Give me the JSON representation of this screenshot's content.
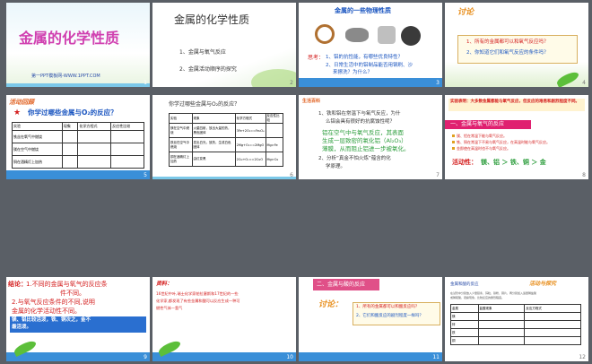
{
  "slides": [
    {
      "num": "1",
      "title": "金属的化学性质",
      "sub": "第一PPT模板网-WWW.1PPT.COM"
    },
    {
      "num": "2",
      "title": "金属的化学性质",
      "items": [
        "1、金属与氧气反应",
        "2、金属活动顺序的探究"
      ]
    },
    {
      "num": "3",
      "title": "金属的一些物理性质",
      "q_label": "思考：",
      "q1": "1、铝的抗性能，有哪些优良特性？",
      "q2": "2、日常生活中的铝制品能否用钢刷、沙",
      "q3": "来擦洗？为什么？"
    },
    {
      "num": "4",
      "title": "讨论",
      "items": [
        "1、所有的金属都可以和氧气反应吗？",
        "2、你知道它们和氧气反应的条件吗？"
      ]
    },
    {
      "num": "5",
      "banner": "活动回顾",
      "q": "你学过哪些金属与O₂的反应？",
      "headers": [
        "实验",
        "现象",
        "化学方程式",
        "反应性比较"
      ],
      "rows": [
        "铁丝在氧气中燃烧",
        "镁在空气中燃烧",
        "铜在酒精灯上加热"
      ]
    },
    {
      "num": "6",
      "q": "你学过哪些金属与O₂的反应？",
      "headers": [
        "实验",
        "现象",
        "化学方程式",
        "反应性比较"
      ],
      "rows": [
        [
          "镁在空气中燃烧",
          "火星四射，放出大量的热，黑色固体",
          "3Fe+2O₂==Fe₃O₄",
          ""
        ],
        [
          "铁丝在空气中燃烧",
          "发出白光，放热，生成白色固体",
          "2Mg+O₂==2MgO",
          "Mg>Fe"
        ],
        [
          "铜在酒精灯上加热",
          "由红变黑",
          "2Cu+O₂==2CuO",
          "Mg>Cu"
        ]
      ]
    },
    {
      "num": "7",
      "label": "生活百科",
      "q1": "1、铁和铝在常温下与氧气反应，为什",
      "q2": "么铝会具有很好的抗腐蚀性呢？",
      "a1": "铝在空气中与氧气反应，其表面",
      "a2": "生成一层致密的氧化铝（Al₂O₃）",
      "a3": "薄膜，从而阻止铝进一步被氧化。",
      "q3": "2、分析“真金不怕火炼”蕴含的化",
      "q4": "学原理。"
    },
    {
      "num": "8",
      "box": "实验表明：大多数金属都能与氧气反应，但反应的难易和剧烈程度不同。",
      "heading": "一、金属与氧气的反应",
      "b1": "镁、铝在常温下能与氧气反应。",
      "b2": "铁、铜在常温下不易与氧气反应，在高温时能与氧气反应。",
      "b3": "金即使在高温时也不与氧气反应。",
      "rank_label": "活动性：",
      "rank": "镁、铝 ＞ 铁、铜 ＞ 金"
    },
    {
      "num": "9",
      "c_label": "结论：",
      "c1": "1.不同的金属与氧气的反应条",
      "c2": "件不同。",
      "c3": "2.与氧气反应条件的不同,说明",
      "c4": "金属的化学活动性不同。",
      "box1": "镁、铝比较活泼，铁、铜次之，金不",
      "box2": "最活泼。"
    },
    {
      "num": "10",
      "label": "资料：",
      "l1": "16世纪中叶,瑞士化学家帕拉塞斯和17世纪的一些",
      "l2": "化学家,都发现了有些金属和酸可以反应生成一种可",
      "l3": "燃性气体—氢气"
    },
    {
      "num": "11",
      "title": "二、金属与酸的反应",
      "label": "讨论：",
      "items": [
        "1、所有的金属都可以和酸反应吗？",
        "2、它们和酸反应的剧烈程度一样吗？"
      ]
    },
    {
      "num": "12",
      "left": "金属和酸的反应",
      "right": "活动与探究",
      "text1": "在试管中分别放入少量镁条、锌粒、铁粉、铜片，再分别加入适量稀盐酸",
      "text2": "或稀硫酸，观察现象，比较反应的剧烈程度。",
      "headers": [
        "金属",
        "盐酸现象",
        "反应方程式"
      ],
      "rows": [
        "镁",
        "锌",
        "铁",
        "铜"
      ]
    }
  ]
}
